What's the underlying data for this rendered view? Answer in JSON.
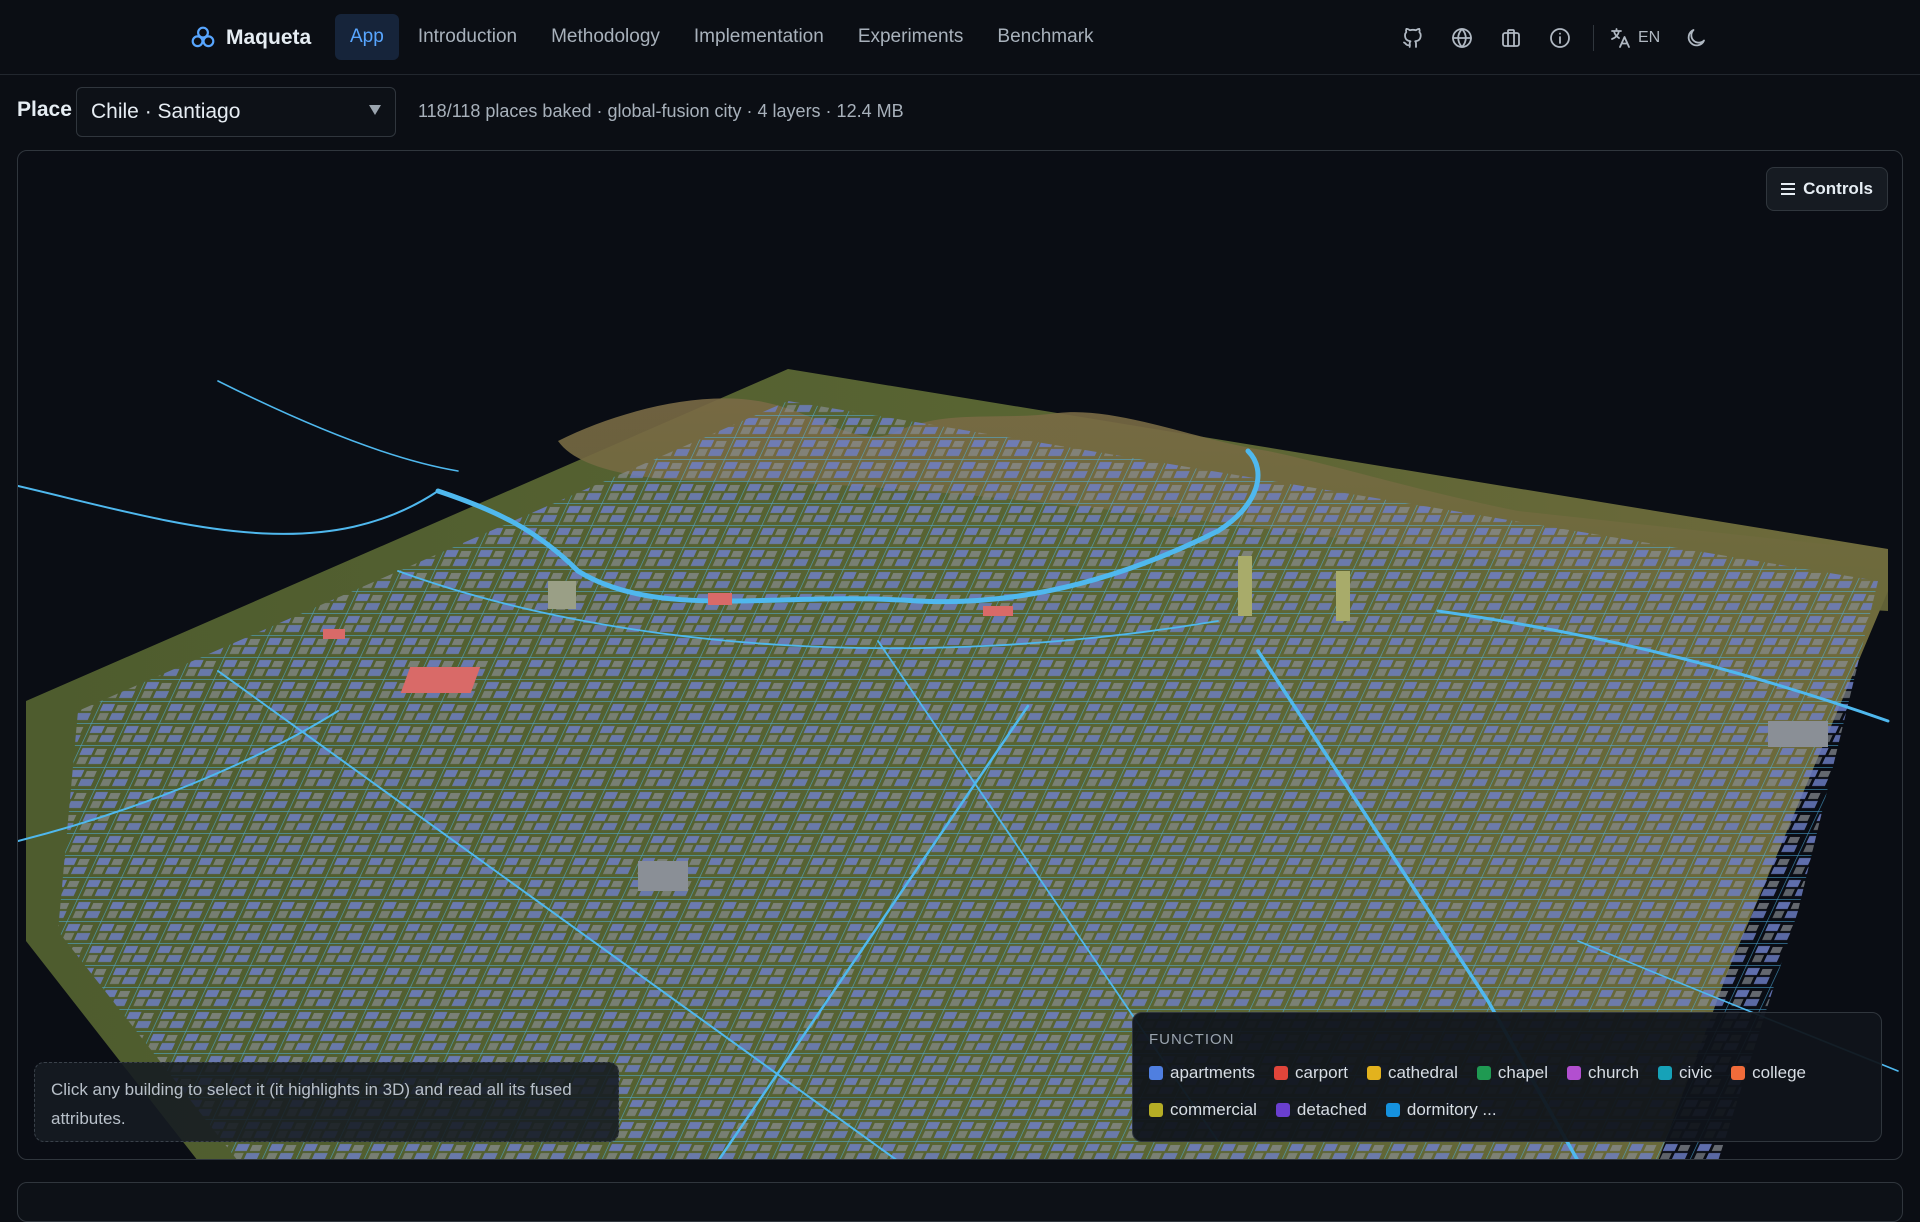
{
  "brand": {
    "name": "Maqueta"
  },
  "nav": {
    "links": [
      "App",
      "Introduction",
      "Methodology",
      "Implementation",
      "Experiments",
      "Benchmark"
    ],
    "active": "App"
  },
  "header_icons": [
    "github-icon",
    "globe-icon",
    "briefcase-icon",
    "info-icon",
    "translate-icon",
    "moon-icon"
  ],
  "language": "EN",
  "place": {
    "label": "Place",
    "selected": "Chile · Santiago",
    "status": "118/118 places baked · global-fusion city · 4 layers · 12.4 MB"
  },
  "viewer": {
    "controls_label": "Controls",
    "hint": "Click any building to select it (it highlights in 3D) and read all its fused attributes."
  },
  "legend": {
    "title": "FUNCTION",
    "items": [
      {
        "label": "apartments",
        "color": "#4f7fe0"
      },
      {
        "label": "carport",
        "color": "#e0453a"
      },
      {
        "label": "cathedral",
        "color": "#e3b21d"
      },
      {
        "label": "chapel",
        "color": "#1f9a52"
      },
      {
        "label": "church",
        "color": "#b24fd0"
      },
      {
        "label": "civic",
        "color": "#16a2b8"
      },
      {
        "label": "college",
        "color": "#f06b3a"
      },
      {
        "label": "commercial",
        "color": "#b5ad25"
      },
      {
        "label": "detached",
        "color": "#6a3fd0"
      },
      {
        "label": "dormitory ...",
        "color": "#1592e0"
      }
    ]
  },
  "colors": {
    "background": "#0b0e14",
    "accent": "#58a6ff",
    "terrain": "#5b6a35",
    "hills": "#7a6a45",
    "roads": "#4fb8ee",
    "buildings_residential": "#6e7fc8",
    "buildings_other": "#8a8f96"
  }
}
